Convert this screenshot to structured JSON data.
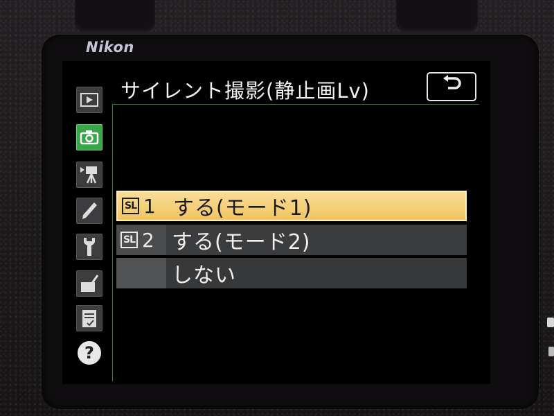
{
  "device": {
    "brand": "Nikon"
  },
  "menu": {
    "title": "サイレント撮影(静止画Lv)",
    "back_icon": "return-arrow-icon"
  },
  "sidebar": {
    "items": [
      {
        "name": "playback-menu",
        "icon": "play-icon",
        "active": false
      },
      {
        "name": "photo-shooting-menu",
        "icon": "camera-icon",
        "active": true
      },
      {
        "name": "movie-shooting-menu",
        "icon": "movie-camera-icon",
        "active": false
      },
      {
        "name": "custom-settings-menu",
        "icon": "pencil-icon",
        "active": false
      },
      {
        "name": "setup-menu",
        "icon": "wrench-icon",
        "active": false
      },
      {
        "name": "retouch-menu",
        "icon": "retouch-brush-icon",
        "active": false
      },
      {
        "name": "my-menu",
        "icon": "my-menu-list-icon",
        "active": false
      },
      {
        "name": "help",
        "icon": "help-icon",
        "active": false
      }
    ]
  },
  "options": [
    {
      "badge": "SL",
      "number": "1",
      "label": "する(モード1)",
      "selected": true
    },
    {
      "badge": "SL",
      "number": "2",
      "label": "する(モード2)",
      "selected": false
    },
    {
      "badge": "",
      "number": "",
      "label": "しない",
      "selected": false
    }
  ],
  "colors": {
    "active_tab": "#3aa64a",
    "selected_row": "#f0c462",
    "accent_line": "#2e7a2e"
  }
}
